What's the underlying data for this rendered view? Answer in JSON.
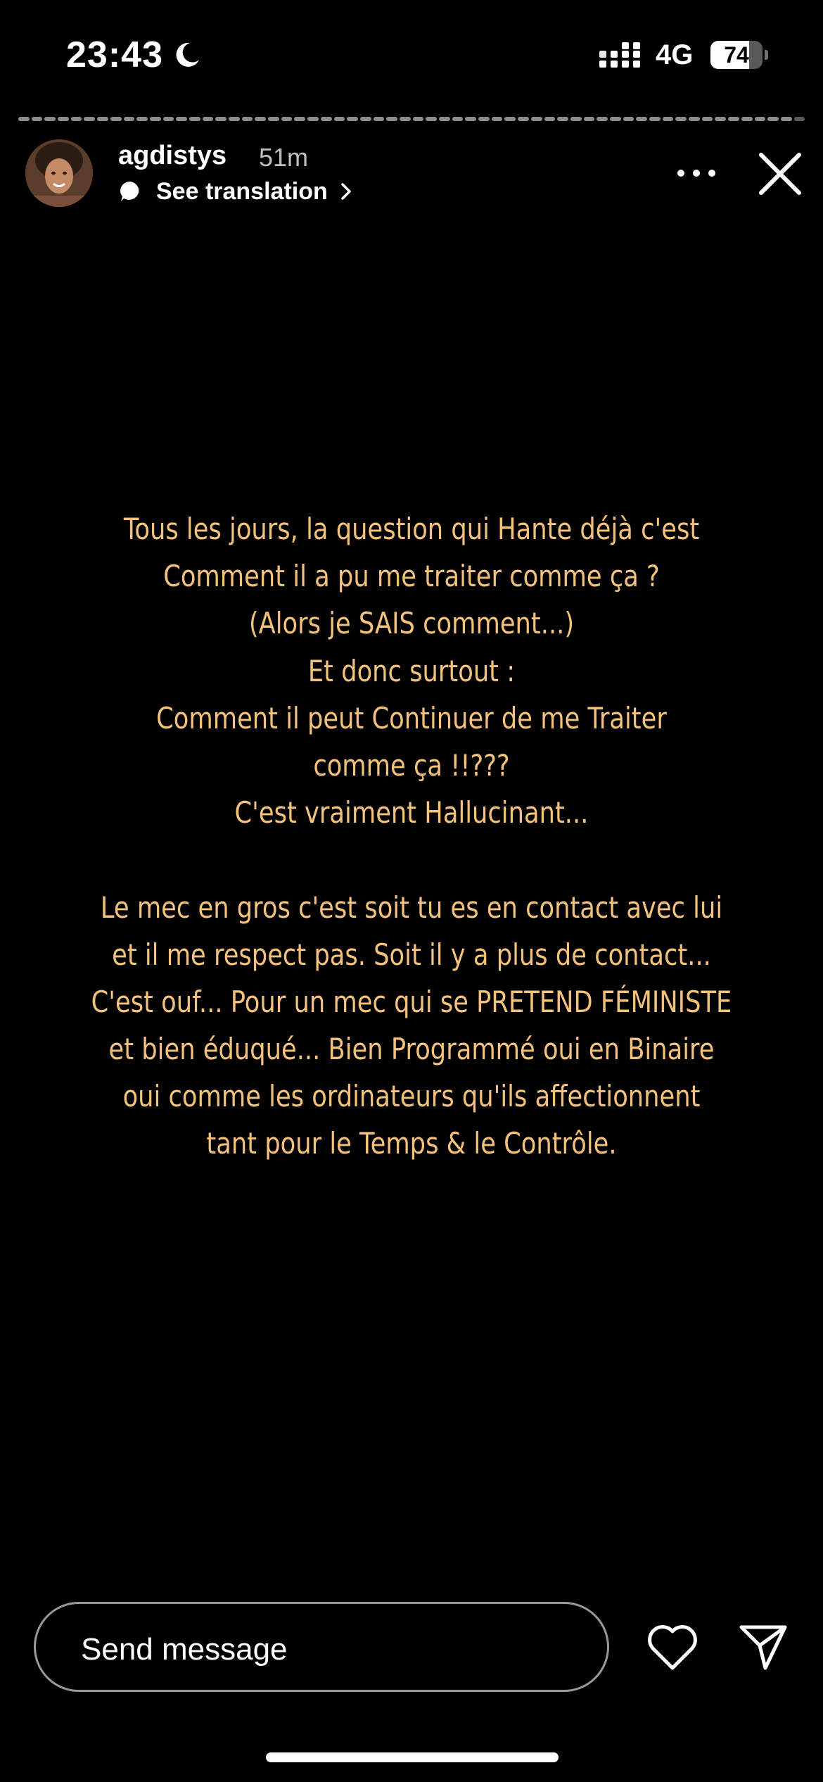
{
  "status_bar": {
    "time": "23:43",
    "network": "4G",
    "battery_level": "74",
    "battery_fraction": 0.74
  },
  "story": {
    "segments_total": 60,
    "active_segment": 60,
    "username": "agdistys",
    "time_ago": "51m",
    "translation_label": "See translation",
    "text_lines": [
      "Tous les jours, la question qui Hante déjà c'est",
      "Comment il a pu me traiter comme ça ?",
      "(Alors je SAIS comment...)",
      "Et donc surtout :",
      "Comment il peut Continuer de me Traiter",
      "comme ça !!???",
      "C'est vraiment Hallucinant...",
      "",
      "Le mec en gros c'est soit tu es en contact avec lui",
      "et il me respect pas. Soit il y a plus de contact...",
      "C'est ouf... Pour un mec qui se PRETEND FÉMINISTE",
      "et bien éduqué... Bien Programmé oui en Binaire",
      "oui comme les ordinateurs qu'ils affectionnent",
      "tant pour le Temps & le Contrôle."
    ],
    "text_color": "#f4c27a"
  },
  "footer": {
    "send_placeholder": "Send message"
  },
  "icons": {
    "moon": "moon-icon",
    "signal": "cellular-signal-icon",
    "battery": "battery-icon",
    "translate": "translate-bubble-icon",
    "more": "more-options-icon",
    "close": "close-icon",
    "like": "heart-icon",
    "share": "send-paper-plane-icon"
  }
}
